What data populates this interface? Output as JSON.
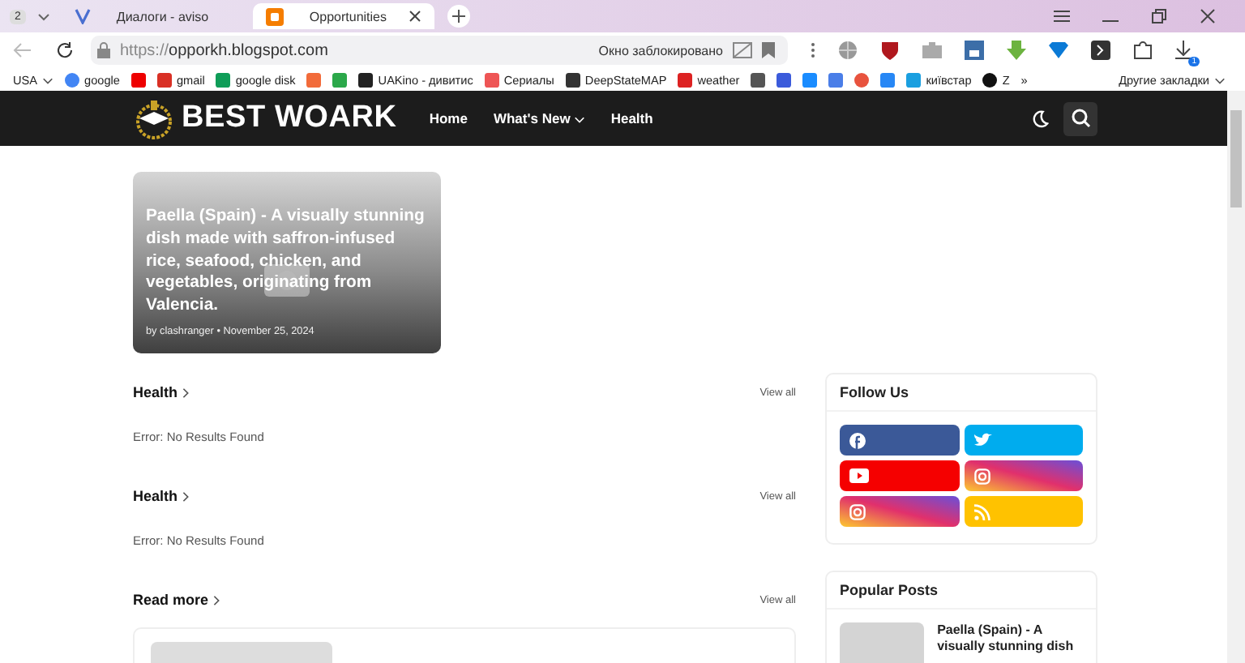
{
  "browser": {
    "tab_count": "2",
    "tabs": [
      {
        "title": "Диалоги - aviso",
        "selected": false
      },
      {
        "title": "Opportunities",
        "selected": true
      }
    ],
    "url": {
      "scheme": "https://",
      "host": "opporkh.blogspot.com"
    },
    "popup_notice": "Окно заблокировано",
    "extension_badge": "1",
    "bookmarks": [
      {
        "label": "USA",
        "kind": "menu"
      },
      {
        "label": "google",
        "kind": "google"
      },
      {
        "kind": "youtube"
      },
      {
        "label": "gmail",
        "kind": "gmail"
      },
      {
        "label": "google disk",
        "kind": "drive"
      },
      {
        "kind": "f"
      },
      {
        "kind": "puzzle"
      },
      {
        "label": "UAKino - дивитис",
        "kind": "uakino"
      },
      {
        "label": "Сериалы",
        "kind": "brush"
      },
      {
        "label": "DeepStateMAP",
        "kind": "deepstate"
      },
      {
        "label": "weather",
        "kind": "thermo"
      },
      {
        "kind": "bc"
      },
      {
        "kind": "arrow"
      },
      {
        "kind": "p"
      },
      {
        "kind": "translate"
      },
      {
        "kind": "s"
      },
      {
        "kind": "vk"
      },
      {
        "label": "київстар",
        "kind": "star"
      },
      {
        "label": "Z",
        "kind": "z"
      }
    ],
    "more": "»",
    "other_bookmarks": "Другие закладки"
  },
  "site": {
    "logo": "BEST WOARK",
    "nav": [
      {
        "label": "Home",
        "dropdown": false
      },
      {
        "label": "What's New",
        "dropdown": true
      },
      {
        "label": "Health",
        "dropdown": false
      }
    ]
  },
  "hero": {
    "title": "Paella (Spain) - A visually stunning dish made with saffron-infused rice, seafood, chicken, and vegetables, originating from Valencia.",
    "byline": "by clashranger • November 25, 2024"
  },
  "sections": [
    {
      "title": "Health",
      "link": "View all",
      "message": "Error: No Results Found"
    },
    {
      "title": "Health",
      "link": "View all",
      "message": "Error: No Results Found"
    },
    {
      "title": "Read more",
      "link": "View all"
    }
  ],
  "follow": {
    "title": "Follow Us",
    "buttons": [
      {
        "kind": "facebook"
      },
      {
        "kind": "twitter"
      },
      {
        "kind": "youtube"
      },
      {
        "kind": "instagram"
      },
      {
        "kind": "instagram"
      },
      {
        "kind": "rss"
      }
    ]
  },
  "popular": {
    "title": "Popular Posts",
    "post": "Paella (Spain) - A visually stunning dish"
  }
}
